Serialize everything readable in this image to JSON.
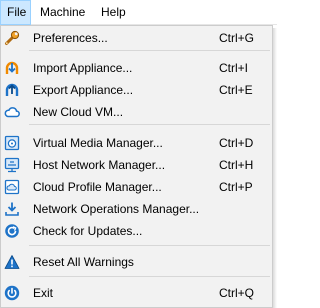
{
  "menubar": {
    "items": [
      {
        "label": "File"
      },
      {
        "label": "Machine"
      },
      {
        "label": "Help"
      }
    ]
  },
  "file_menu": {
    "items": [
      {
        "label": "Preferences...",
        "shortcut": "Ctrl+G",
        "icon": "wrench-icon"
      },
      {
        "label": "Import Appliance...",
        "shortcut": "Ctrl+I",
        "icon": "import-appliance-icon"
      },
      {
        "label": "Export Appliance...",
        "shortcut": "Ctrl+E",
        "icon": "export-appliance-icon"
      },
      {
        "label": "New Cloud VM...",
        "shortcut": "",
        "icon": "cloud-vm-icon"
      },
      {
        "label": "Virtual Media Manager...",
        "shortcut": "Ctrl+D",
        "icon": "media-manager-icon"
      },
      {
        "label": "Host Network Manager...",
        "shortcut": "Ctrl+H",
        "icon": "host-network-icon"
      },
      {
        "label": "Cloud Profile Manager...",
        "shortcut": "Ctrl+P",
        "icon": "cloud-profile-icon"
      },
      {
        "label": "Network Operations Manager...",
        "shortcut": "",
        "icon": "download-icon"
      },
      {
        "label": "Check for Updates...",
        "shortcut": "",
        "icon": "refresh-icon"
      },
      {
        "label": "Reset All Warnings",
        "shortcut": "",
        "icon": "warning-icon"
      },
      {
        "label": "Exit",
        "shortcut": "Ctrl+Q",
        "icon": "power-icon"
      }
    ]
  },
  "colors": {
    "menu_background": "#f2f2f2",
    "active_menubar_item": "#cce8ff",
    "icon_blue": "#1e73c8",
    "icon_orange": "#f08a00"
  }
}
